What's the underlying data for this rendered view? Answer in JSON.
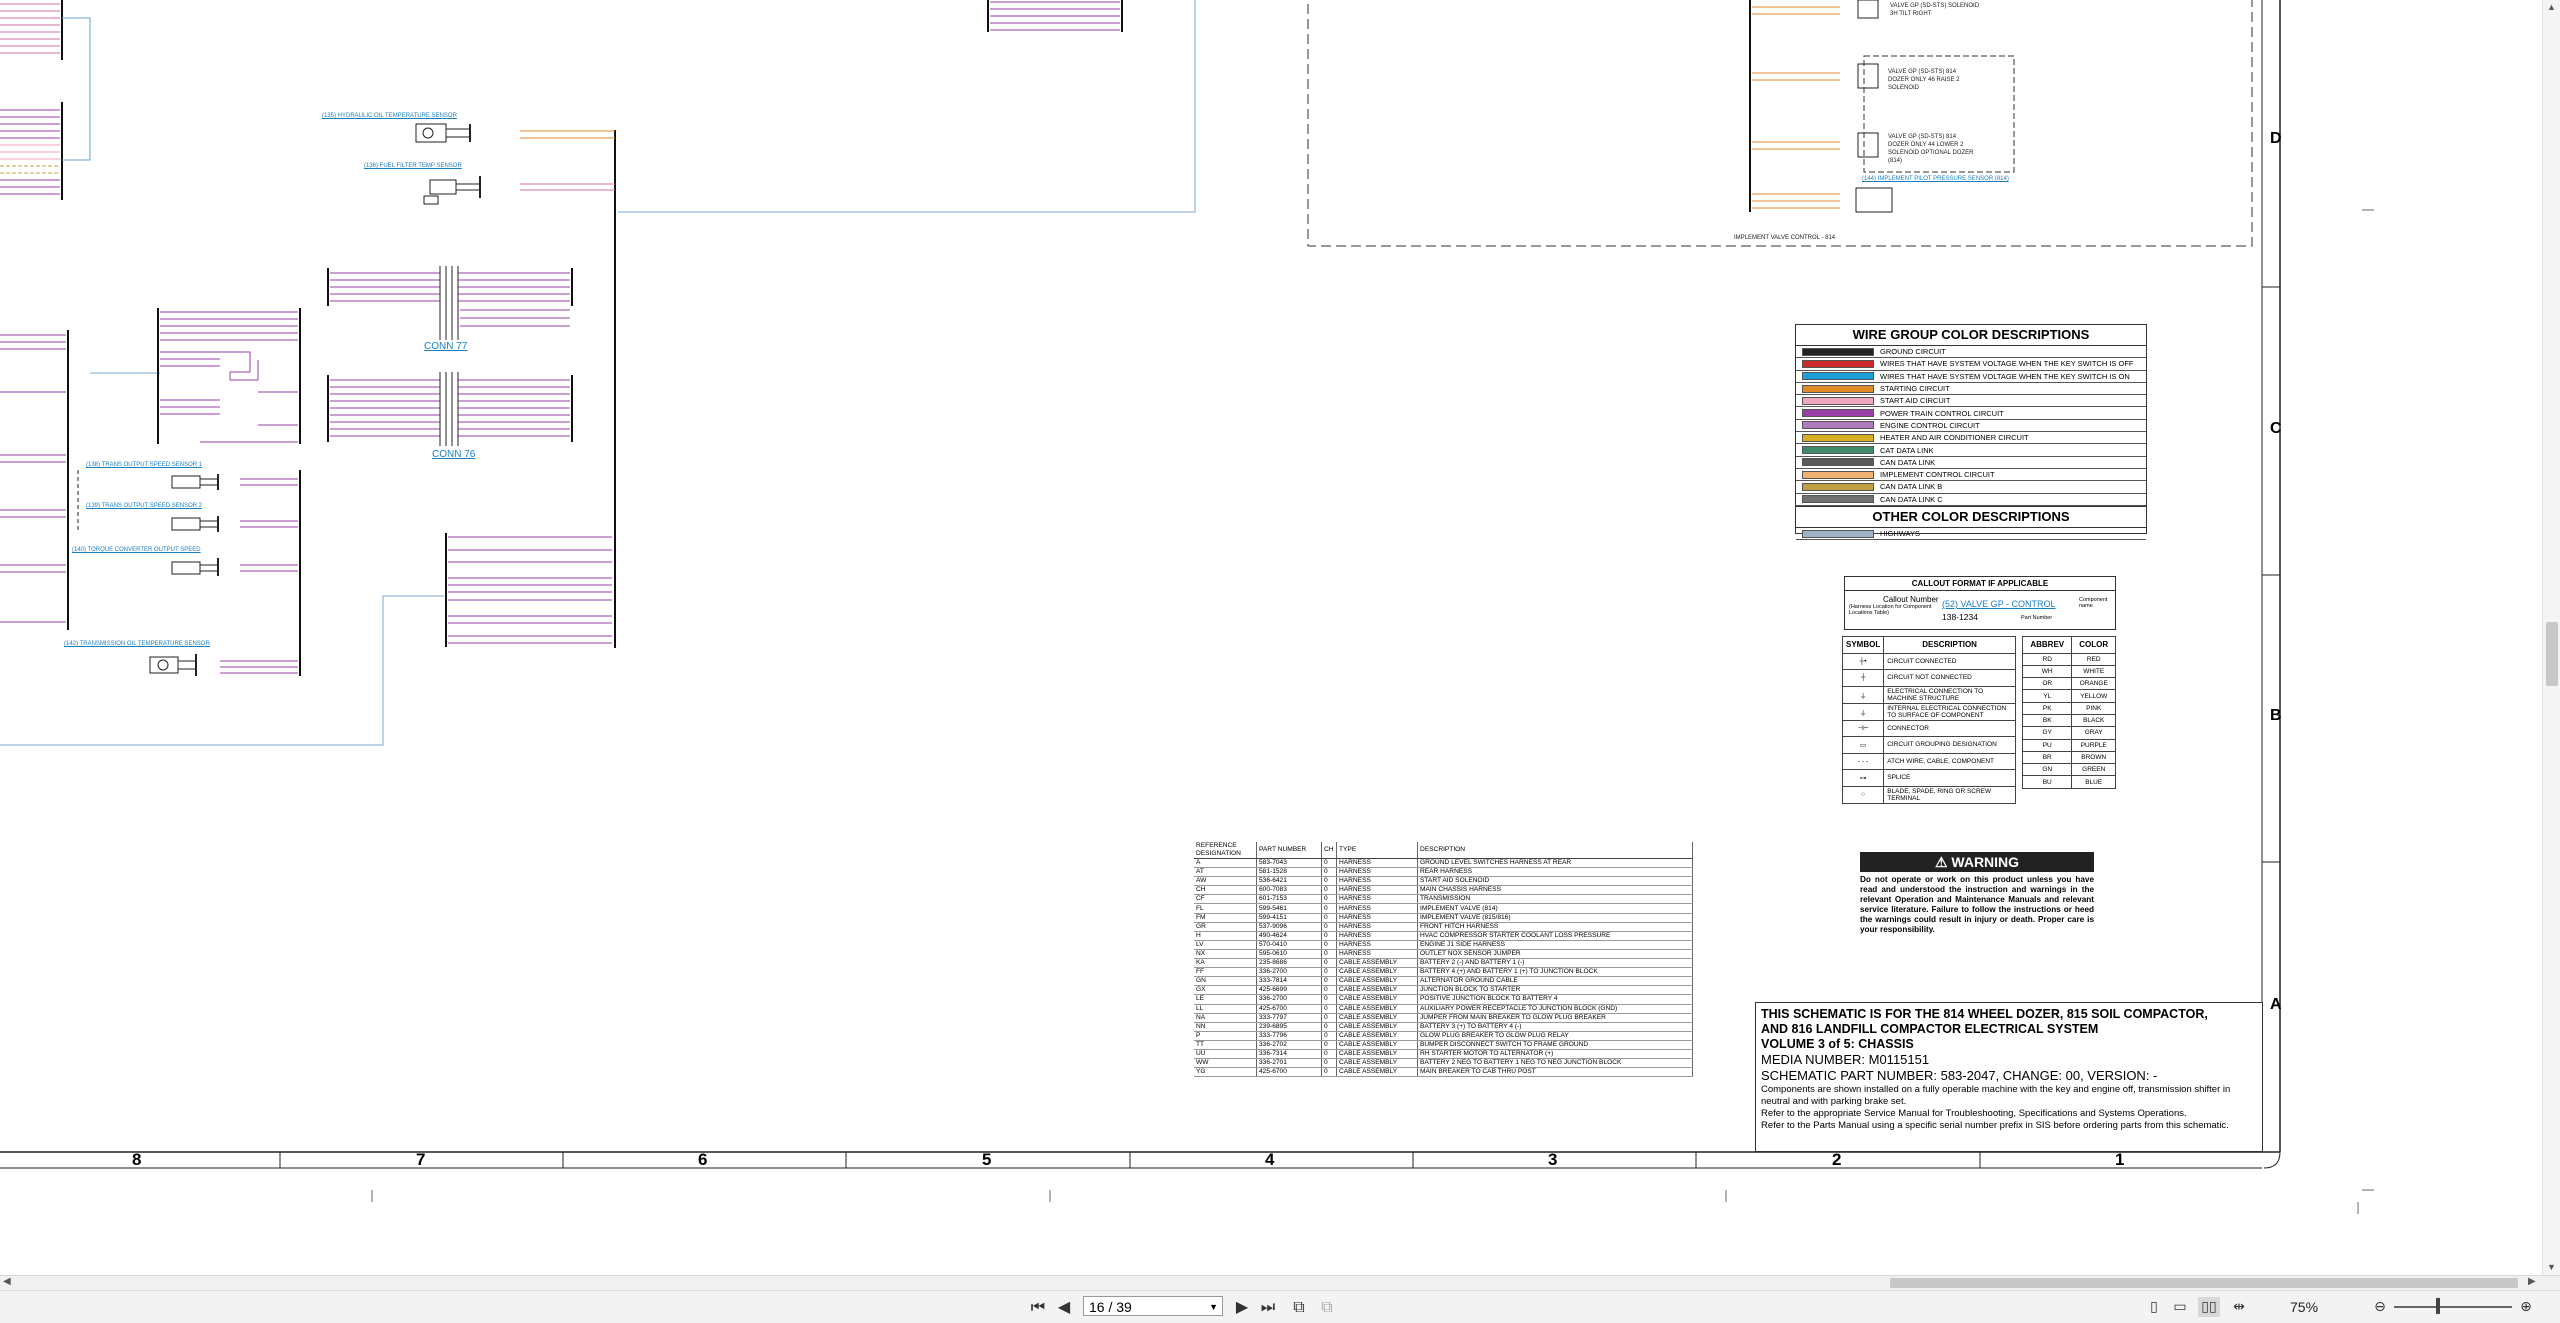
{
  "document": {
    "legend": {
      "title": "WIRE GROUP COLOR DESCRIPTIONS",
      "other_title": "OTHER COLOR DESCRIPTIONS",
      "rows": [
        {
          "label": "GROUND CIRCUIT",
          "color": "#222222"
        },
        {
          "label": "WIRES THAT HAVE SYSTEM VOLTAGE WHEN THE KEY SWITCH IS OFF",
          "color": "#cc2a2a"
        },
        {
          "label": "WIRES THAT HAVE SYSTEM VOLTAGE WHEN THE KEY SWITCH IS ON",
          "color": "#1a9fd6"
        },
        {
          "label": "STARTING CIRCUIT",
          "color": "#e08a2a"
        },
        {
          "label": "START AID CIRCUIT",
          "color": "#f0a6c0"
        },
        {
          "label": "POWER TRAIN CONTROL CIRCUIT",
          "color": "#9a3fa8"
        },
        {
          "label": "ENGINE CONTROL CIRCUIT",
          "color": "#b07cc0"
        },
        {
          "label": "HEATER AND AIR CONDITIONER CIRCUIT",
          "color": "#d6b020"
        },
        {
          "label": "CAT DATA LINK",
          "color": "#3f8a6a"
        },
        {
          "label": "CAN DATA LINK",
          "color": "#5a5a5a"
        },
        {
          "label": "IMPLEMENT CONTROL CIRCUIT",
          "color": "#f2b070"
        },
        {
          "label": "CAN DATA LINK B",
          "color": "#c0a040"
        },
        {
          "label": "CAN DATA LINK C",
          "color": "#707070"
        }
      ],
      "other_rows": [
        {
          "label": "HIGHWAYS",
          "color": "#9fb3c8"
        }
      ]
    },
    "callout": {
      "title": "CALLOUT FORMAT IF APPLICABLE",
      "callout_number": "Callout Number",
      "callout_note": "(Harness Location for Component Locations Table)",
      "link_text": "(52) VALVE GP - CONTROL",
      "component_note": "Component name",
      "part_number": "138-1234",
      "part_note": "Part Number"
    },
    "symbols": {
      "headers": [
        "SYMBOL",
        "DESCRIPTION"
      ],
      "rows": [
        {
          "sym": "┼•",
          "desc": "CIRCUIT CONNECTED"
        },
        {
          "sym": "┼",
          "desc": "CIRCUIT NOT CONNECTED"
        },
        {
          "sym": "⏚",
          "desc": "ELECTRICAL CONNECTION TO MACHINE STRUCTURE"
        },
        {
          "sym": "⏚",
          "desc": "INTERNAL ELECTRICAL CONNECTION TO SURFACE OF COMPONENT"
        },
        {
          "sym": "⊣⊢",
          "desc": "CONNECTOR"
        },
        {
          "sym": "▭",
          "desc": "CIRCUIT GROUPING DESIGNATION"
        },
        {
          "sym": "- - -",
          "desc": "ATCH WIRE, CABLE, COMPONENT"
        },
        {
          "sym": "⊶",
          "desc": "SPLICE"
        },
        {
          "sym": "○",
          "desc": "BLADE, SPADE, RING OR SCREW TERMINAL"
        }
      ]
    },
    "abbrev": {
      "headers": [
        "ABBREV",
        "COLOR"
      ],
      "rows": [
        [
          "RD",
          "RED"
        ],
        [
          "WH",
          "WHITE"
        ],
        [
          "OR",
          "ORANGE"
        ],
        [
          "YL",
          "YELLOW"
        ],
        [
          "PK",
          "PINK"
        ],
        [
          "BK",
          "BLACK"
        ],
        [
          "GY",
          "GRAY"
        ],
        [
          "PU",
          "PURPLE"
        ],
        [
          "BR",
          "BROWN"
        ],
        [
          "GN",
          "GREEN"
        ],
        [
          "BU",
          "BLUE"
        ]
      ]
    },
    "warning": {
      "title": "WARNING",
      "body": "Do not operate or work on this product unless you have read and understood the instruction and warnings in the relevant Operation and Maintenance Manuals and relevant service literature. Failure to follow the instructions or heed the warnings could result in injury or death. Proper care is your responsibility."
    },
    "title_block": {
      "line1": "THIS SCHEMATIC IS FOR THE 814 WHEEL DOZER, 815 SOIL COMPACTOR,",
      "line2": "AND 816 LANDFILL COMPACTOR ELECTRICAL SYSTEM",
      "line3": "VOLUME 3 of 5: CHASSIS",
      "media": "MEDIA NUMBER: M0115151",
      "part": "SCHEMATIC PART NUMBER: 583-2047, CHANGE: 00, VERSION: -",
      "note1": "Components are shown installed on a fully operable machine with the key and engine off, transmission shifter in neutral and with parking brake set.",
      "note2": "Refer to the appropriate Service Manual for Troubleshooting, Specifications and Systems Operations.",
      "note3": "Refer to the Parts Manual using a specific serial number prefix in SIS before ordering parts from this schematic."
    },
    "ref_table": {
      "headers": [
        "REFERENCE DESIGNATION",
        "PART NUMBER",
        "CH",
        "TYPE",
        "DESCRIPTION"
      ],
      "rows": [
        [
          "A",
          "583-7043",
          "0",
          "HARNESS",
          "GROUND LEVEL SWITCHES HARNESS AT REAR"
        ],
        [
          "AT",
          "581-1528",
          "0",
          "HARNESS",
          "REAR HARNESS"
        ],
        [
          "AW",
          "536-6421",
          "0",
          "HARNESS",
          "START AID SOLENOID"
        ],
        [
          "CH",
          "600-7083",
          "0",
          "HARNESS",
          "MAIN CHASSIS HARNESS"
        ],
        [
          "CF",
          "601-7153",
          "0",
          "HARNESS",
          "TRANSMISSION"
        ],
        [
          "FL",
          "599-5461",
          "0",
          "HARNESS",
          "IMPLEMENT VALVE (814)"
        ],
        [
          "FM",
          "599-4151",
          "0",
          "HARNESS",
          "IMPLEMENT VALVE (815/816)"
        ],
        [
          "GR",
          "537-9096",
          "0",
          "HARNESS",
          "FRONT HITCH HARNESS"
        ],
        [
          "H",
          "490-4624",
          "0",
          "HARNESS",
          "HVAC COMPRESSOR STARTER COOLANT LOSS PRESSURE"
        ],
        [
          "LV",
          "570-0410",
          "0",
          "HARNESS",
          "ENGINE J1 SIDE HARNESS"
        ],
        [
          "NX",
          "595-0610",
          "0",
          "HARNESS",
          "OUTLET NOX SENSOR JUMPER"
        ],
        [
          "KA",
          "235-8686",
          "0",
          "CABLE ASSEMBLY",
          "BATTERY 2 (-) AND BATTERY 1 (-)"
        ],
        [
          "FF",
          "336-2700",
          "0",
          "CABLE ASSEMBLY",
          "BATTERY 4 (+) AND BATTERY 1 (+) TO JUNCTION BLOCK"
        ],
        [
          "GN",
          "333-7814",
          "0",
          "CABLE ASSEMBLY",
          "ALTERNATOR GROUND CABLE"
        ],
        [
          "GX",
          "425-6699",
          "0",
          "CABLE ASSEMBLY",
          "JUNCTION BLOCK TO STARTER"
        ],
        [
          "LE",
          "336-2700",
          "0",
          "CABLE ASSEMBLY",
          "POSITIVE JUNCTION BLOCK TO BATTERY 4"
        ],
        [
          "LL",
          "425-6700",
          "0",
          "CABLE ASSEMBLY",
          "AUXILIARY POWER RECEPTACLE TO JUNCTION BLOCK (GND)"
        ],
        [
          "NA",
          "333-7797",
          "0",
          "CABLE ASSEMBLY",
          "JUMPER FROM MAIN BREAKER TO GLOW PLUG BREAKER"
        ],
        [
          "NN",
          "239-6895",
          "0",
          "CABLE ASSEMBLY",
          "BATTERY 3 (+) TO BATTERY 4 (-)"
        ],
        [
          "P",
          "333-7796",
          "0",
          "CABLE ASSEMBLY",
          "GLOW PLUG BREAKER TO GLOW PLUG RELAY"
        ],
        [
          "TT",
          "336-2702",
          "0",
          "CABLE ASSEMBLY",
          "BUMPER DISCONNECT SWITCH TO FRAME GROUND"
        ],
        [
          "UU",
          "336-7314",
          "0",
          "CABLE ASSEMBLY",
          "RH STARTER MOTOR TO ALTERNATOR (+)"
        ],
        [
          "WW",
          "336-2701",
          "0",
          "CABLE ASSEMBLY",
          "BATTERY 2 NEG TO BATTERY 1 NEG TO NEG JUNCTION BLOCK"
        ],
        [
          "YG",
          "425-6700",
          "0",
          "CABLE ASSEMBLY",
          "MAIN BREAKER TO CAB THRU POST"
        ]
      ]
    },
    "schematic_labels": {
      "conn77": "CONN 77",
      "conn76": "CONN 76",
      "hyd_temp": "(135) HYDRAULIC OIL TEMPERATURE SENSOR",
      "fuel_temp": "(136) FUEL FILTER TEMP SENSOR",
      "output_speed1": "(138) TRANS OUTPUT SPEED SENSOR 1",
      "output_speed2": "(139) TRANS OUTPUT SPEED SENSOR 2",
      "torque_conv": "(140) TORQUE CONVERTER OUTPUT SPEED",
      "trans_oil_temp": "(142) TRANSMISSION OIL TEMPERATURE SENSOR",
      "impl_valve": "IMPLEMENT VALVE CONTROL - 814",
      "valve_tilt": "VALVE GP (SD-STS) SOLENOID 3H TILT RIGHT",
      "valve_raise": "VALVE GP (SD-STS) 814 DOZER ONLY 46 RAISE 2 SOLENOID",
      "valve_lower": "VALVE GP (SD-STS) 814 DOZER ONLY 44 LOWER 2 SOLENOID OPTIONAL DOZER (814)",
      "pilot_pressure": "(144) IMPLEMENT PILOT PRESSURE SENSOR (814)"
    },
    "grid": {
      "columns": [
        "8",
        "7",
        "6",
        "5",
        "4",
        "3",
        "2",
        "1"
      ],
      "rows": [
        "D",
        "C",
        "B",
        "A"
      ]
    }
  },
  "viewer": {
    "page_current": "16 / 39",
    "zoom": "75%",
    "icons": {
      "first": "first-page-icon",
      "prev": "previous-page-icon",
      "next": "next-page-icon",
      "last": "last-page-icon",
      "fit": "fit-page-icon",
      "fit_width": "fit-width-icon",
      "single": "single-page-icon",
      "continuous": "continuous-page-icon",
      "two_page": "two-page-icon",
      "spread": "spread-icon",
      "zoom_out": "zoom-out-icon",
      "zoom_in": "zoom-in-icon"
    }
  }
}
